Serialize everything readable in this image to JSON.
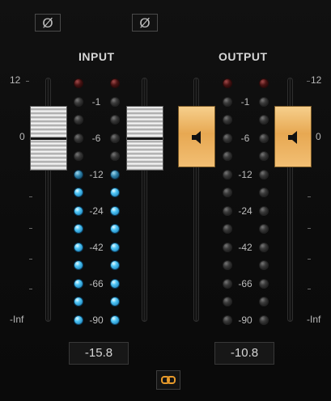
{
  "input": {
    "phase_label": "Ø",
    "header": "INPUT",
    "scale_top": "12",
    "scale_zero": "0",
    "scale_bottom": "-Inf",
    "readout": "-15.8",
    "lit_level": -12
  },
  "output": {
    "phase_label": "Ø",
    "header": "OUTPUT",
    "scale_top": "12",
    "scale_zero": "0",
    "scale_bottom": "-Inf",
    "readout": "-10.8"
  },
  "meter_labels": [
    "-1",
    "-6",
    "-12",
    "-24",
    "-42",
    "-66",
    "-90"
  ],
  "link_icon": "link-icon",
  "speaker_icon": "speaker-icon",
  "colors": {
    "led_blue": "#4fc6f6",
    "fader_gold": "#e7a852",
    "link_orange": "#e79a2b"
  }
}
